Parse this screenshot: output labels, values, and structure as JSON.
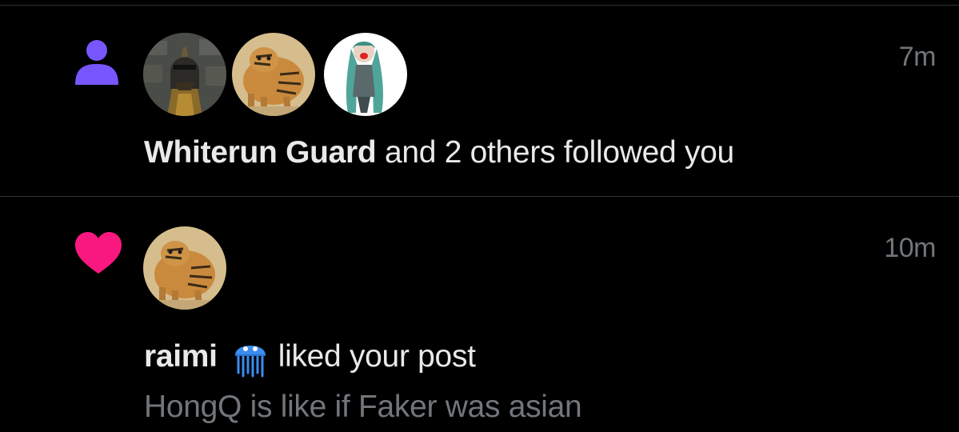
{
  "colors": {
    "background": "#000000",
    "divider": "#2f3336",
    "text_primary": "#e7e9ea",
    "text_secondary": "#71767b",
    "follow_icon": "#7856ff",
    "like_icon": "#f91880"
  },
  "notifications": [
    {
      "type": "follow",
      "icon": "person-icon",
      "avatars": [
        "whiterun-guard-avatar",
        "tiger-painting-avatar",
        "teal-haired-figure-avatar"
      ],
      "timestamp": "7m",
      "actor": "Whiterun Guard",
      "action": " and 2 others followed you"
    },
    {
      "type": "like",
      "icon": "heart-icon",
      "avatars": [
        "tiger-painting-avatar"
      ],
      "timestamp": "10m",
      "actor": "raimi",
      "actor_emoji": "jellyfish-emoji",
      "action": "liked your post",
      "post_preview": "HongQ is like if Faker was asian"
    }
  ]
}
